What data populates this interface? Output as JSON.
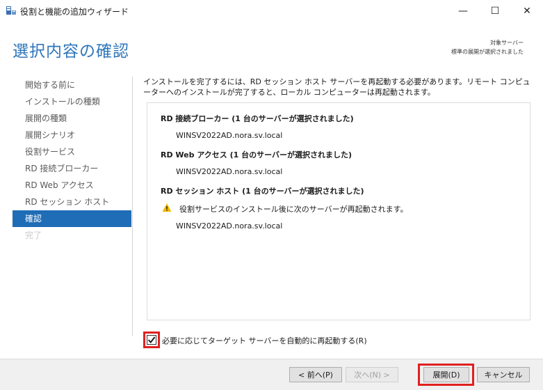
{
  "window": {
    "title": "役割と機能の追加ウィザード",
    "minimize_glyph": "—",
    "maximize_glyph": "☐",
    "close_glyph": "✕"
  },
  "header": {
    "page_title": "選択内容の確認",
    "target_label": "対象サーバー",
    "target_value": "標準の展開が選択されました"
  },
  "nav": {
    "items": [
      {
        "label": "開始する前に",
        "state": "normal"
      },
      {
        "label": "インストールの種類",
        "state": "normal"
      },
      {
        "label": "展開の種類",
        "state": "normal"
      },
      {
        "label": "展開シナリオ",
        "state": "normal"
      },
      {
        "label": "役割サービス",
        "state": "normal"
      },
      {
        "label": "RD 接続ブローカー",
        "state": "normal"
      },
      {
        "label": "RD Web アクセス",
        "state": "normal"
      },
      {
        "label": "RD セッション ホスト",
        "state": "normal"
      },
      {
        "label": "確認",
        "state": "active"
      },
      {
        "label": "完了",
        "state": "disabled"
      }
    ]
  },
  "main": {
    "intro": "インストールを完了するには、RD セッション ホスト サーバーを再起動する必要があります。リモート コンピューターへのインストールが完了すると、ローカル コンピューターは再起動されます。",
    "summary": {
      "broker_head": "RD 接続ブローカー (1 台のサーバーが選択されました)",
      "broker_server": "WINSV2022AD.nora.sv.local",
      "web_head": "RD Web アクセス (1 台のサーバーが選択されました)",
      "web_server": "WINSV2022AD.nora.sv.local",
      "session_head": "RD セッション ホスト (1 台のサーバーが選択されました)",
      "session_warning": "役割サービスのインストール後に次のサーバーが再起動されます。",
      "session_server": "WINSV2022AD.nora.sv.local"
    },
    "restart_checkbox_label": "必要に応じてターゲット サーバーを自動的に再起動する(R)",
    "restart_checked": true
  },
  "footer": {
    "prev_label": "< 前へ(P)",
    "next_label": "次へ(N) >",
    "deploy_label": "展開(D)",
    "cancel_label": "キャンセル"
  },
  "colors": {
    "accent": "#1f6db6",
    "title": "#2f76ba",
    "highlight_border": "#e02020",
    "warning": "#f2b900"
  },
  "icons": {
    "app": "server-manager-icon",
    "warning": "warning-icon",
    "check": "checkmark-icon"
  }
}
